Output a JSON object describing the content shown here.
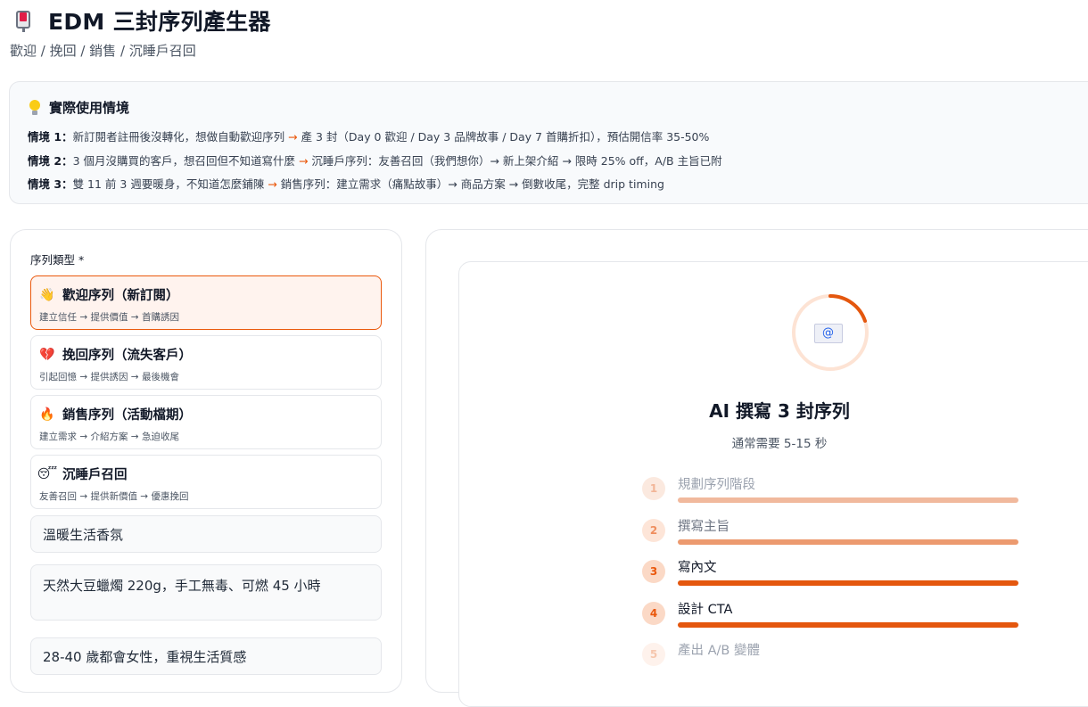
{
  "header": {
    "title": "EDM 三封序列產生器",
    "subtitle": "歡迎 / 挽回 / 銷售 / 沉睡戶召回"
  },
  "scenario": {
    "heading": "實際使用情境",
    "lines": [
      {
        "label": "情境 1：",
        "pre": "新訂閱者註冊後沒轉化，想做自動歡迎序列 ",
        "arrow": "→",
        "post": " 產 3 封（Day 0 歡迎 / Day 3 品牌故事 / Day 7 首購折扣），預估開信率 35-50%"
      },
      {
        "label": "情境 2：",
        "pre": "3 個月沒購買的客戶，想召回但不知道寫什麼 ",
        "arrow": "→",
        "post": " 沉睡戶序列：友善召回（我們想你）→ 新上架介紹 → 限時 25% off，A/B 主旨已附"
      },
      {
        "label": "情境 3：",
        "pre": "雙 11 前 3 週要暖身，不知道怎麼鋪陳 ",
        "arrow": "→",
        "post": " 銷售序列：建立需求（痛點故事）→ 商品方案 → 倒數收尾，完整 drip timing"
      }
    ]
  },
  "form": {
    "sequence_type_label": "序列類型 *",
    "options": [
      {
        "emoji": "👋",
        "title": "歡迎序列（新訂閱）",
        "desc": "建立信任 → 提供價值 → 首購誘因",
        "selected": true
      },
      {
        "emoji": "💔",
        "title": "挽回序列（流失客戶）",
        "desc": "引起回憶 → 提供誘因 → 最後機會",
        "selected": false
      },
      {
        "emoji": "🔥",
        "title": "銷售序列（活動檔期）",
        "desc": "建立需求 → 介紹方案 → 急迫收尾",
        "selected": false
      },
      {
        "emoji": "😴",
        "title": "沉睡戶召回",
        "desc": "友善召回 → 提供新價值 → 優惠挽回",
        "selected": false
      }
    ],
    "brand_value": "溫暖生活香氛",
    "product_value": "天然大豆蠟燭 220g，手工無毒、可燃 45 小時",
    "audience_value": "28-40 歲都會女性，重視生活質感"
  },
  "progress": {
    "title": "AI 撰寫 3 封序列",
    "subtitle": "通常需要 5-15 秒",
    "steps": [
      {
        "num": "1",
        "label": "規劃序列階段",
        "state": "faint"
      },
      {
        "num": "2",
        "label": "撰寫主旨",
        "state": "mid"
      },
      {
        "num": "3",
        "label": "寫內文",
        "state": "strong"
      },
      {
        "num": "4",
        "label": "設計 CTA",
        "state": "strong"
      },
      {
        "num": "5",
        "label": "產出 A/B 變體",
        "state": "pending"
      }
    ],
    "accent": "#ea580c"
  }
}
